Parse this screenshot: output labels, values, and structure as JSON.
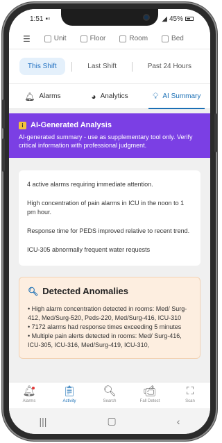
{
  "status": {
    "time": "1:51",
    "battery": "45%"
  },
  "filters": [
    {
      "label": "Unit"
    },
    {
      "label": "Floor"
    },
    {
      "label": "Room"
    },
    {
      "label": "Bed"
    }
  ],
  "range_tabs": [
    {
      "label": "This Shift",
      "active": true
    },
    {
      "label": "Last Shift",
      "active": false
    },
    {
      "label": "Past 24 Hours",
      "active": false
    }
  ],
  "section_tabs": [
    {
      "label": "Alarms",
      "icon": "bell-icon"
    },
    {
      "label": "Analytics",
      "icon": "pie-chart-icon"
    },
    {
      "label": "AI Summary",
      "icon": "lightbulb-icon",
      "active": true
    }
  ],
  "ai_banner": {
    "title": "AI-Generated Analysis",
    "subtitle": "AI-generated summary - use as supplementary tool only. Verify critical information with professional judgment."
  },
  "summary": [
    "4 active alarms requiring immediate attention.",
    "High concentration of pain alarms in ICU in the noon to 1 pm hour.",
    "Response time for PEDS improved relative to recent trend.",
    "ICU-305 abnormally frequent water requests"
  ],
  "anomalies": {
    "title": "Detected Anomalies",
    "items": [
      "• High alarm concentration detected in rooms: Med/ Surg-412, Med/Surg-520, Peds-220, Med/Surg-416, ICU-310",
      "• 7172 alarms had response times exceeding 5 minutes",
      "• Multiple pain alerts detected in rooms: Med/ Surg-416, ICU-305, ICU-316, Med/Surg-419, ICU-310,"
    ]
  },
  "bottom_nav": [
    {
      "label": "Alarms",
      "icon": "bell-icon"
    },
    {
      "label": "Activity",
      "icon": "clipboard-icon",
      "active": true
    },
    {
      "label": "Search",
      "icon": "search-icon"
    },
    {
      "label": "Fall Detect",
      "icon": "camera-icon"
    },
    {
      "label": "Scan",
      "icon": "qr-scan-icon"
    }
  ],
  "colors": {
    "accent": "#1a6fb5",
    "banner": "#7b3fe4",
    "anomaly_bg": "#fdeee0"
  }
}
